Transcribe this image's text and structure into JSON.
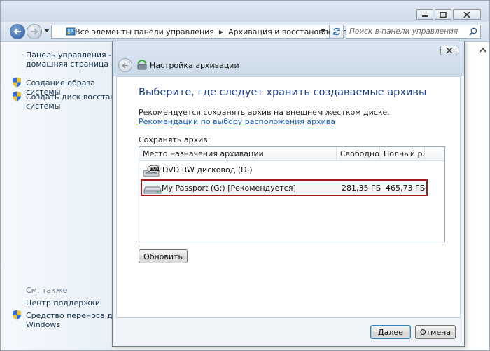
{
  "window": {
    "address": {
      "segments": [
        "Все элементы панели управления",
        "Архивация и восстановление"
      ]
    },
    "search": {
      "placeholder": "Поиск в панели управления"
    }
  },
  "left_pane": {
    "home_link": [
      "Панель управления -",
      "домашняя страница"
    ],
    "tasks": [
      {
        "label": [
          "Создание образа системы"
        ],
        "icon": "shield-icon"
      },
      {
        "label": [
          "Создать диск восстановлен",
          "системы"
        ],
        "icon": "shield-icon"
      }
    ],
    "see_also": {
      "heading": "См. также",
      "items": [
        {
          "label": [
            "Центр поддержки"
          ]
        },
        {
          "label": [
            "Средство переноса данных",
            "Windows"
          ],
          "icon": "shield-icon"
        }
      ]
    }
  },
  "dialog": {
    "title": "Настройка архивации",
    "instruction": "Выберите, где следует хранить создаваемые архивы",
    "recommendation": "Рекомендуется сохранять архив на внешнем жестком диске.",
    "recommendation_link": "Рекомендации по выбору расположения архива",
    "save_label": "Сохранять архив:",
    "columns": [
      "Место назначения архивации",
      "Свободно",
      "Полный р..."
    ],
    "destinations": [
      {
        "name": "DVD RW дисковод (D:)",
        "free": "",
        "total": "",
        "icon": "dvd-drive-icon",
        "selected": false
      },
      {
        "name": "My Passport (G:) [Рекомендуется]",
        "free": "281,35 ГБ",
        "total": "465,73 ГБ",
        "icon": "hard-drive-icon",
        "selected": true
      }
    ],
    "refresh_label": "Обновить",
    "next_label": "Далее",
    "cancel_label": "Отмена"
  }
}
